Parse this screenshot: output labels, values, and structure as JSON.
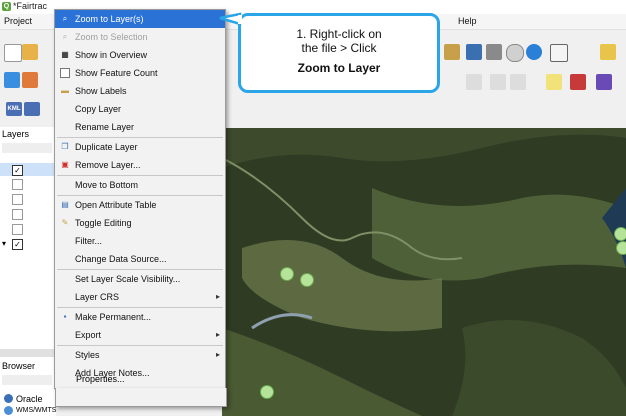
{
  "window": {
    "title": "*Fairtrac"
  },
  "menubar": {
    "items": [
      "Project",
      "Help"
    ]
  },
  "panels": {
    "layers_title": "Layers",
    "browser_title": "Browser",
    "browser_items": [
      "Oracle",
      "WMS/WMTS"
    ]
  },
  "toolbar": {
    "kml_label": "KML"
  },
  "context_menu": {
    "items": [
      {
        "label": "Zoom to Layer(s)",
        "highlighted": true
      },
      {
        "label": "Zoom to Selection",
        "disabled": true
      },
      {
        "label": "Show in Overview"
      },
      {
        "label": "Show Feature Count"
      },
      {
        "label": "Show Labels"
      },
      {
        "label": "Copy Layer"
      },
      {
        "label": "Rename Layer"
      },
      {
        "label": "Duplicate Layer"
      },
      {
        "label": "Remove Layer..."
      },
      {
        "label": "Move to Bottom"
      },
      {
        "label": "Open Attribute Table"
      },
      {
        "label": "Toggle Editing"
      },
      {
        "label": "Filter..."
      },
      {
        "label": "Change Data Source..."
      },
      {
        "label": "Set Layer Scale Visibility..."
      },
      {
        "label": "Layer CRS",
        "submenu": true
      },
      {
        "label": "Make Permanent..."
      },
      {
        "label": "Export",
        "submenu": true
      },
      {
        "label": "Styles",
        "submenu": true
      },
      {
        "label": "Add Layer Notes..."
      },
      {
        "label": "Properties..."
      }
    ]
  },
  "callout": {
    "line1": "1. Right-click on",
    "line2": "the file > Click",
    "line3": "Zoom to Layer"
  },
  "colors": {
    "highlight": "#2a72d6",
    "callout_border": "#2aa6e8",
    "marker": "#b6e39a"
  }
}
